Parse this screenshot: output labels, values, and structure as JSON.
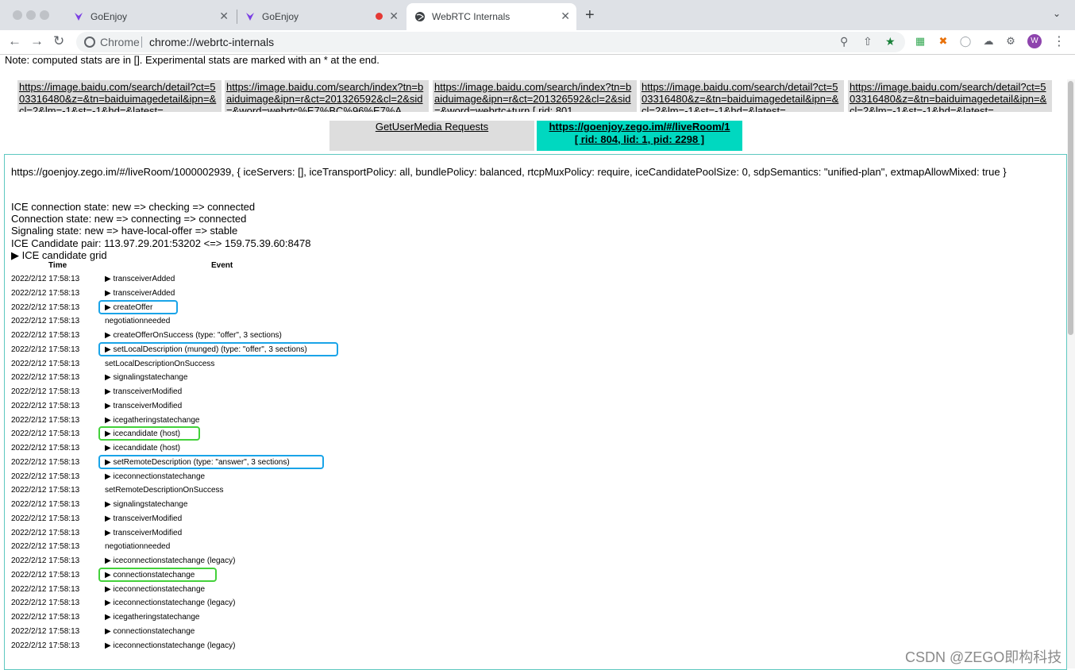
{
  "tabs": [
    {
      "title": "GoEnjoy",
      "icon": "goenjoy-icon"
    },
    {
      "title": "GoEnjoy",
      "icon": "goenjoy-icon",
      "recording": true
    },
    {
      "title": "WebRTC Internals",
      "icon": "globe-icon",
      "active": true
    }
  ],
  "newtab_glyph": "+",
  "close_glyph": "✕",
  "omnibox": {
    "site_label": "Chrome",
    "url": "chrome://webrtc-internals"
  },
  "avatar_initial": "W",
  "note": "Note: computed stats are in []. Experimental stats are marked with an * at the end.",
  "url_tabs": [
    "https://image.baidu.com/search/detail?ct=503316480&z=&tn=baiduimagedetail&ipn=&cl=2&lm=-1&st=-1&hd=&latest=",
    "https://image.baidu.com/search/index?tn=baiduimage&ipn=r&ct=201326592&cl=2&sid=&word=webrtc%E7%BC%96%E7%A",
    "https://image.baidu.com/search/index?tn=baiduimage&ipn=r&ct=201326592&cl=2&sid=&word=webrtc+turn [ rid: 801",
    "https://image.baidu.com/search/detail?ct=503316480&z=&tn=baiduimagedetail&ipn=&cl=2&lm=-1&st=-1&hd=&latest=",
    "https://image.baidu.com/search/detail?ct=503316480&z=&tn=baiduimagedetail&ipn=&cl=2&lm=-1&st=-1&hd=&latest="
  ],
  "selectors": {
    "gum": "GetUserMedia Requests",
    "active_line1": "https://goenjoy.zego.im/#/liveRoom/1",
    "active_line2": "[ rid: 804, lid: 1, pid: 2298 ]"
  },
  "config_text": "https://goenjoy.zego.im/#/liveRoom/1000002939, { iceServers: [], iceTransportPolicy: all, bundlePolicy: balanced, rtcpMuxPolicy: require, iceCandidatePoolSize: 0, sdpSemantics: \"unified-plan\", extmapAllowMixed: true }",
  "states": [
    "ICE connection state: new => checking => connected",
    "Connection state: new => connecting => connected",
    "Signaling state: new => have-local-offer => stable",
    "ICE Candidate pair: 113.97.29.201:53202 <=> 159.75.39.60:8478"
  ],
  "grid_toggle": "▶ ICE candidate grid",
  "table_headers": {
    "time": "Time",
    "event": "Event"
  },
  "events": [
    {
      "time": "2022/2/12 17:58:13",
      "event": "▶  transceiverAdded"
    },
    {
      "time": "2022/2/12 17:58:13",
      "event": "▶  transceiverAdded"
    },
    {
      "time": "2022/2/12 17:58:13",
      "event": "▶  createOffer",
      "hl": "blue",
      "hlw": 100
    },
    {
      "time": "2022/2/12 17:58:13",
      "event": "negotiationneeded"
    },
    {
      "time": "2022/2/12 17:58:13",
      "event": "▶  createOfferOnSuccess (type: \"offer\", 3 sections)"
    },
    {
      "time": "2022/2/12 17:58:13",
      "event": "▶  setLocalDescription (munged) (type: \"offer\", 3 sections)",
      "hl": "blue",
      "hlw": 302
    },
    {
      "time": "2022/2/12 17:58:13",
      "event": "setLocalDescriptionOnSuccess"
    },
    {
      "time": "2022/2/12 17:58:13",
      "event": "▶  signalingstatechange"
    },
    {
      "time": "2022/2/12 17:58:13",
      "event": "▶  transceiverModified"
    },
    {
      "time": "2022/2/12 17:58:13",
      "event": "▶  transceiverModified"
    },
    {
      "time": "2022/2/12 17:58:13",
      "event": "▶  icegatheringstatechange"
    },
    {
      "time": "2022/2/12 17:58:13",
      "event": "▶  icecandidate (host)",
      "hl": "green",
      "hlw": 128
    },
    {
      "time": "2022/2/12 17:58:13",
      "event": "▶  icecandidate (host)"
    },
    {
      "time": "2022/2/12 17:58:13",
      "event": "▶  setRemoteDescription (type: \"answer\", 3 sections)",
      "hl": "blue",
      "hlw": 284
    },
    {
      "time": "2022/2/12 17:58:13",
      "event": "▶  iceconnectionstatechange"
    },
    {
      "time": "2022/2/12 17:58:13",
      "event": "setRemoteDescriptionOnSuccess"
    },
    {
      "time": "2022/2/12 17:58:13",
      "event": "▶  signalingstatechange"
    },
    {
      "time": "2022/2/12 17:58:13",
      "event": "▶  transceiverModified"
    },
    {
      "time": "2022/2/12 17:58:13",
      "event": "▶  transceiverModified"
    },
    {
      "time": "2022/2/12 17:58:13",
      "event": "negotiationneeded"
    },
    {
      "time": "2022/2/12 17:58:13",
      "event": "▶  iceconnectionstatechange (legacy)"
    },
    {
      "time": "2022/2/12 17:58:13",
      "event": "▶  connectionstatechange",
      "hl": "green",
      "hlw": 149
    },
    {
      "time": "2022/2/12 17:58:13",
      "event": "▶  iceconnectionstatechange"
    },
    {
      "time": "2022/2/12 17:58:13",
      "event": "▶  iceconnectionstatechange (legacy)"
    },
    {
      "time": "2022/2/12 17:58:13",
      "event": "▶  icegatheringstatechange"
    },
    {
      "time": "2022/2/12 17:58:13",
      "event": "▶  connectionstatechange"
    },
    {
      "time": "2022/2/12 17:58:13",
      "event": "▶  iceconnectionstatechange (legacy)"
    }
  ],
  "watermark": "CSDN @ZEGO即构科技",
  "colors": {
    "highlight_blue": "#1aa4e8",
    "highlight_green": "#43d13a",
    "active_tab": "#00d8c0"
  }
}
